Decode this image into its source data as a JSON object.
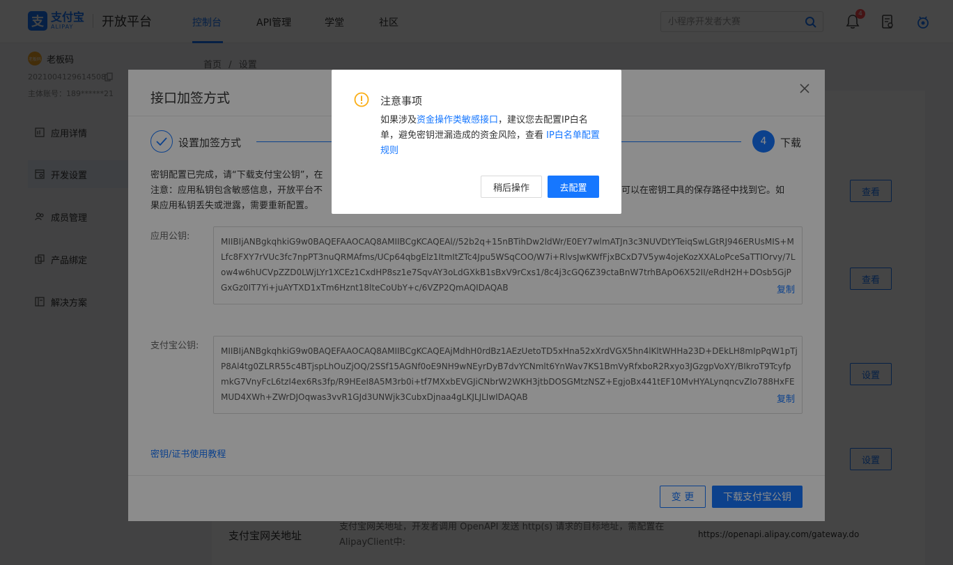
{
  "logo": {
    "mark": "支",
    "brand_cn": "支付宝",
    "brand_en": "ALIPAY",
    "platform": "开放平台"
  },
  "nav": {
    "items": [
      "控制台",
      "API管理",
      "学堂",
      "社区"
    ],
    "active_index": 0
  },
  "search": {
    "placeholder": "小程序开发者大赛"
  },
  "notifications": {
    "badge": "4"
  },
  "user": {
    "avatar_text": "老板码",
    "name": "老板码",
    "id": "2021004129614508",
    "account": "主体账号：189******21"
  },
  "sidebar": {
    "items": [
      {
        "label": "应用详情",
        "icon": "app-detail-icon"
      },
      {
        "label": "开发设置",
        "icon": "dev-settings-icon",
        "active": true
      },
      {
        "label": "成员管理",
        "icon": "members-icon"
      },
      {
        "label": "产品绑定",
        "icon": "product-bind-icon"
      },
      {
        "label": "解决方案",
        "icon": "solution-icon"
      }
    ]
  },
  "breadcrumb": {
    "home": "首页",
    "sep": "/",
    "current": "设置"
  },
  "page_buttons": {
    "view": "查看",
    "set": "设置"
  },
  "gateway": {
    "title": "支付宝网关地址",
    "desc": "支付宝网关地址，开发者调用 OpenAPI 发送 http(s) 请求的目标地址，需配置在AlipayClient中:",
    "url": "https://openapi.alipay.com/gateway.do"
  },
  "dialog": {
    "title": "接口加签方式",
    "step1": "设置加签方式",
    "step4_num": "4",
    "step4": "下载",
    "p1": "密钥配置已完成，请“下载支付宝公钥”，在",
    "p2a": "注意：应用私钥包含敏感信息，开放平台不",
    "p2b": "可以在密钥工具的保存路径中找到它。如",
    "p3": "果应用私钥丢失或泄露，需要重新配置。",
    "app_key_label": "应用公钥:",
    "app_key": "MIIBIjANBgkqhkiG9w0BAQEFAAOCAQ8AMIIBCgKCAQEAl//52b2q+15nBTihDw2ldWr/E0EY7wlmATJn3c3NUVDtYTeiqSwLGtRJ946ERUsMIS+MLfc8FXY7rVUc3fc7npPT3nuQRMAfms/UCp64qbgElz1ItmItZTc4Jpu5WSqCOO/W7i+RlvsJwKWfFjxBCxD7V5yw4ojeKozXXALoPceSaTTIOrvy/7Low4w6hUCVpZZD0LWjLYr1XCEz1CxdHP8sz1e7SqvAY3oLdGXkB1sBxV9rCxs1/8c4j3cGQ6Z39ctaBnW7trhBApO6X52II/eRdH2H+DOsb5GjPGxGz0IT7Yi+juAYTXD1xTm6Hznt18lteCoUbY+c/6VZP2QmAQIDAQAB",
    "alipay_key_label": "支付宝公钥:",
    "alipay_key": "MIIBIjANBgkqhkiG9w0BAQEFAAOCAQ8AMIIBCgKCAQEAjMdhH0rdBz1AEzUetoTD5xHna52xXrdVGX5hn4lKltWHHa23D+DEkLH8mIpPqW1pTjP8Al4tg0ZLRR55c4BTjspLhOuZjOQ/2SSf15AGNf0oE9NH9wNEyrDyB7dvYCNmlt6YnWav7KS1BmVyRfxboR2Rxyo3JGzgpVoXY/BIkroT9TcyfpmkG7VnyFcL6tzI4ex6Rs3fp/R9HEeI8A5M3rb0i+tf7MXxbEVGJiCNbrW2WKH3jtbDOSGMtzNSZ+EgjoBx441tEF10MvHYALynqncvZIo788HxFEMUD4XWh+ZWrDJOqwas3vvR1GJd3UNWjk3CubxDjnaa4gLKJLJLIwIDAQAB",
    "copy": "复制",
    "tutorial": "密钥/证书使用教程",
    "change_btn": "变 更",
    "download_btn": "下载支付宝公钥"
  },
  "notice": {
    "title": "注意事项",
    "t1": "如果涉及",
    "link1": "资金操作类敏感接口",
    "t2": "，建议您去配置IP白名单，避免密钥泄漏造成的资金风险，查看 ",
    "link2": "IP白名单配置规则",
    "later_btn": "稍后操作",
    "config_btn": "去配置"
  },
  "colors": {
    "primary": "#1677ff",
    "warning": "#faad14",
    "badge": "#ff4d4f"
  }
}
